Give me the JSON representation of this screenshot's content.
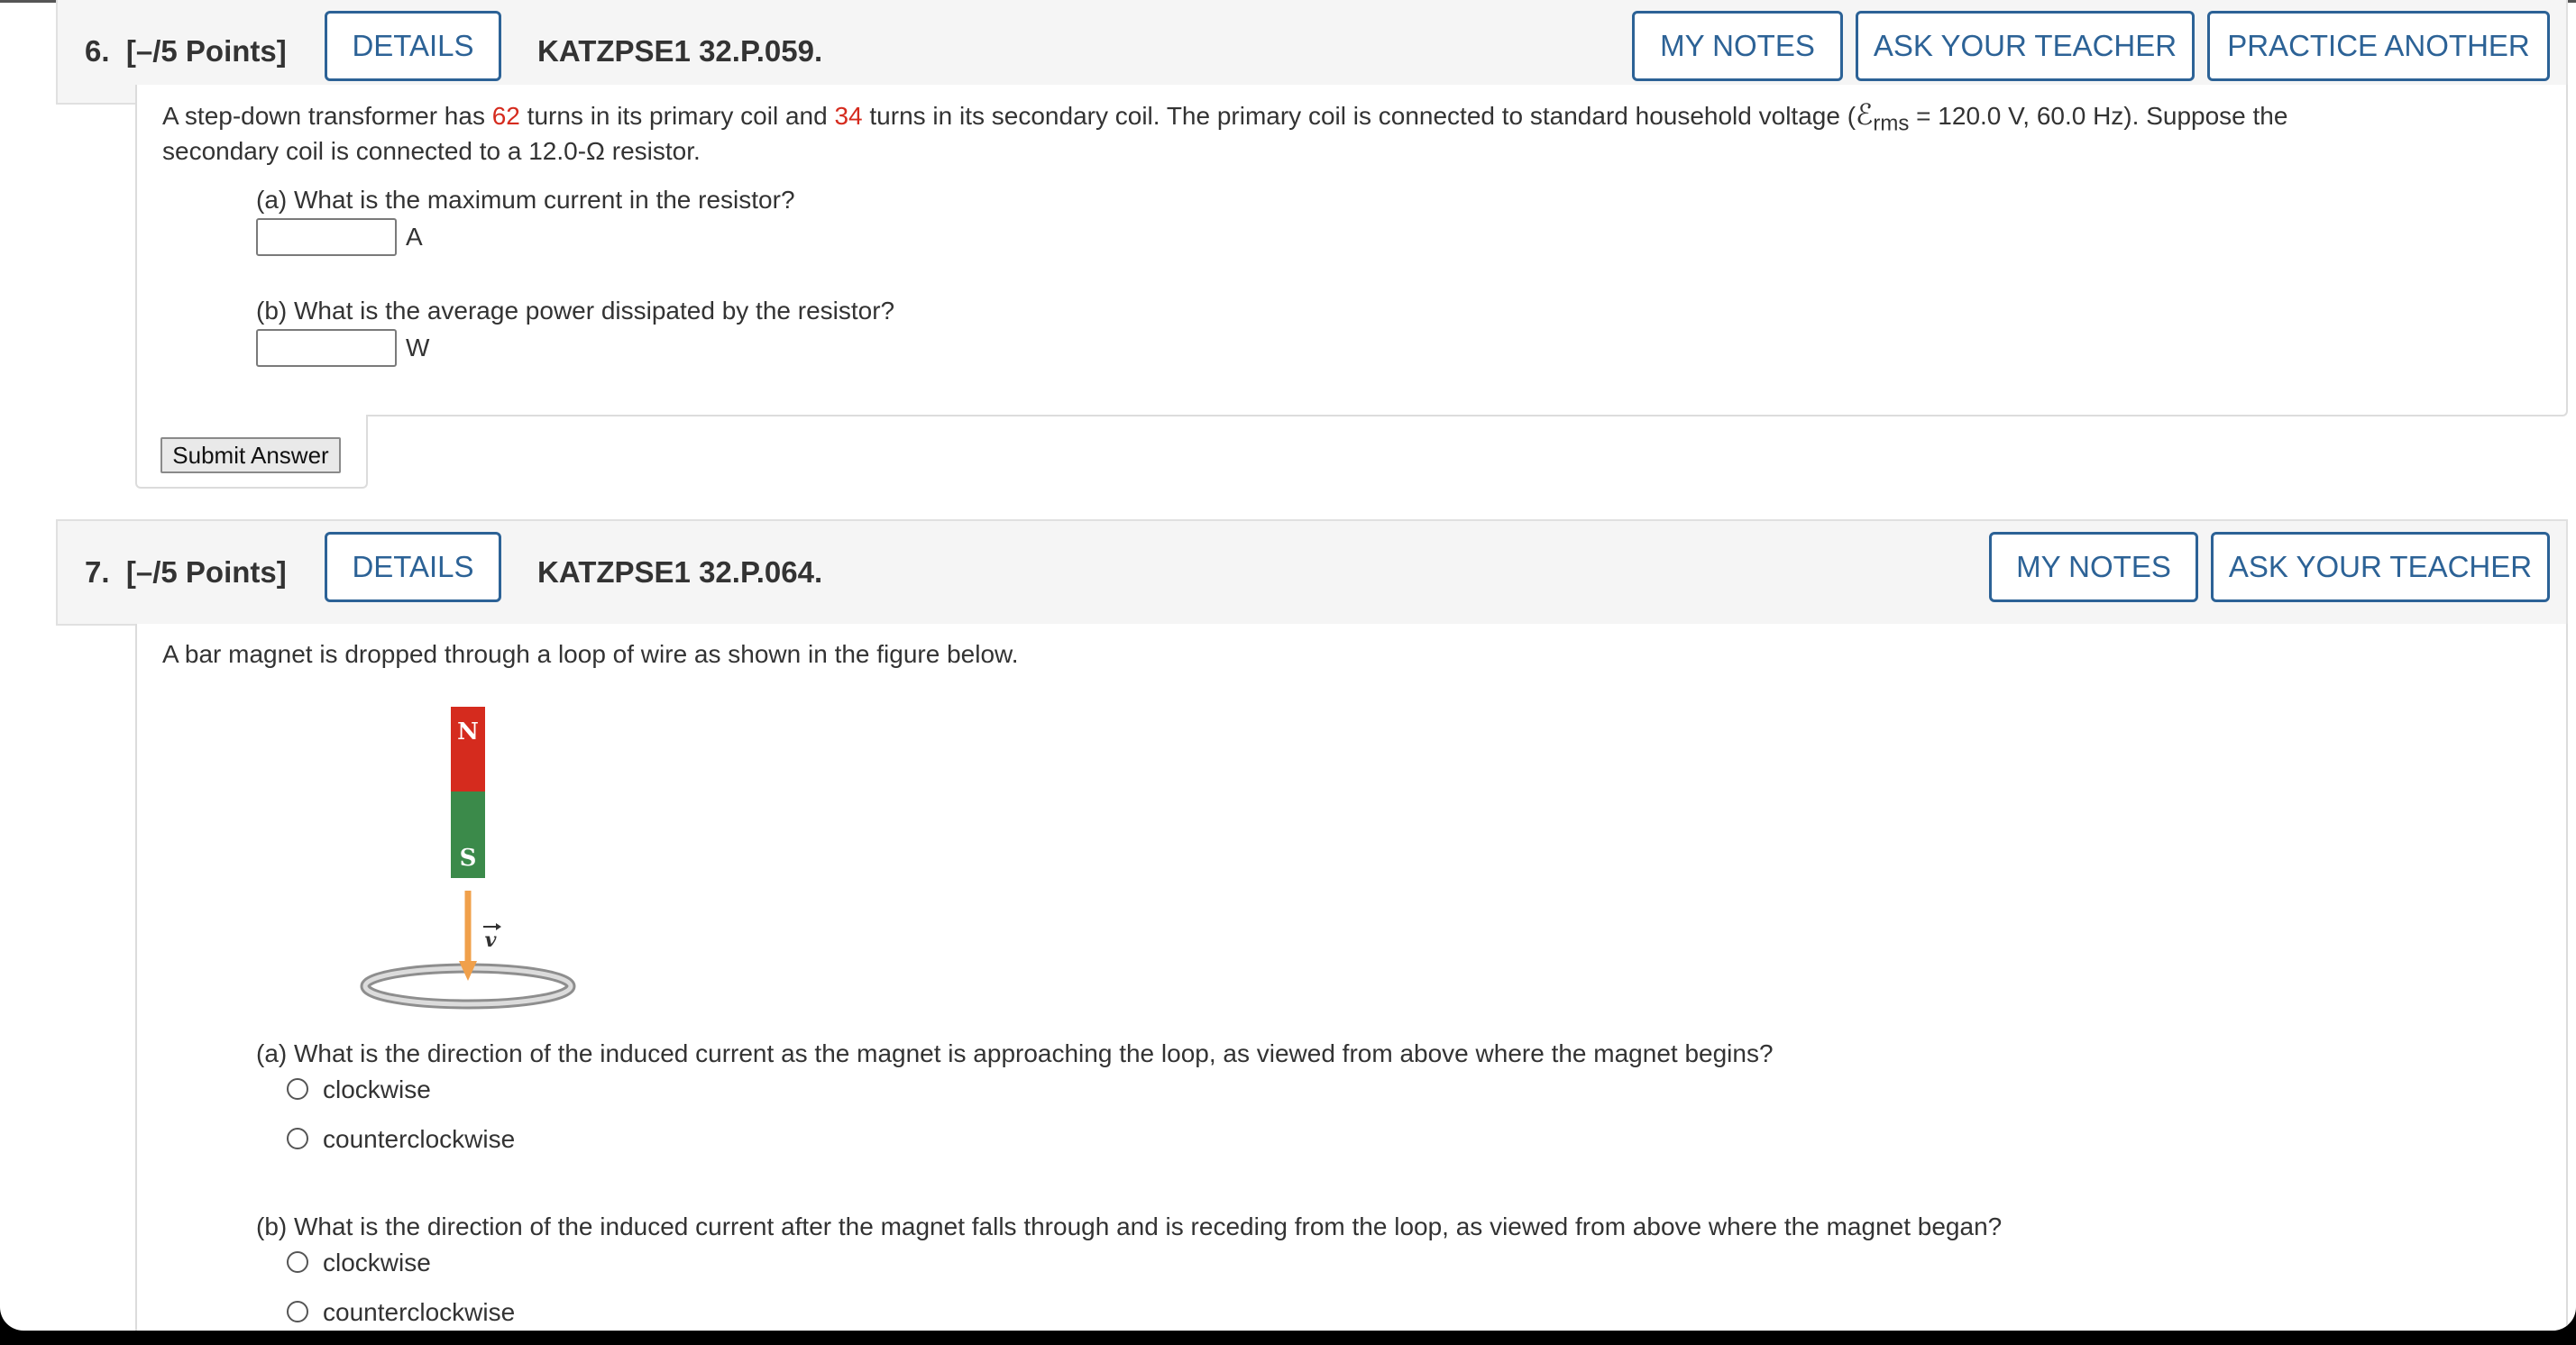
{
  "q6": {
    "number": "6.",
    "points": "[–/5 Points]",
    "details_label": "DETAILS",
    "code": "KATZPSE1 32.P.059.",
    "my_notes_label": "MY NOTES",
    "ask_teacher_label": "ASK YOUR TEACHER",
    "practice_label": "PRACTICE ANOTHER",
    "text_1": "A step-down transformer has",
    "primary_turns": "62",
    "text_2": "turns in its primary coil and",
    "secondary_turns": "34",
    "text_3": "turns in its secondary coil. The primary coil is connected to standard household voltage  (",
    "emf_symbol": "ℰ",
    "emf_sub": "rms",
    "text_4": " = 120.0 V, 60.0 Hz).  Suppose the",
    "text_line2": "secondary coil is connected to a 12.0-Ω resistor.",
    "part_a": "(a) What is the maximum current in the resistor?",
    "part_a_unit": "A",
    "part_b": "(b) What is the average power dissipated by the resistor?",
    "part_b_unit": "W",
    "submit_label": "Submit Answer"
  },
  "q7": {
    "number": "7.",
    "points": "[–/5 Points]",
    "details_label": "DETAILS",
    "code": "KATZPSE1 32.P.064.",
    "my_notes_label": "MY NOTES",
    "ask_teacher_label": "ASK YOUR TEACHER",
    "intro": "A bar magnet is dropped through a loop of wire as shown in the figure below.",
    "figure": {
      "north_label": "N",
      "south_label": "S",
      "velocity_label": "v",
      "north_color": "#d52b1e",
      "south_color": "#3b8a4a",
      "arrow_color": "#f0a04b"
    },
    "part_a": "(a) What is the direction of the induced current as the magnet is approaching the loop, as viewed from above where the magnet begins?",
    "part_a_options": [
      "clockwise",
      "counterclockwise"
    ],
    "part_b": "(b) What is the direction of the induced current after the magnet falls through and is receding from the loop, as viewed from above where the magnet began?",
    "part_b_options": [
      "clockwise",
      "counterclockwise"
    ]
  },
  "colors": {
    "accent": "#2c6296",
    "header_bg": "#f5f5f5",
    "highlight_red": "#d52b1e"
  }
}
